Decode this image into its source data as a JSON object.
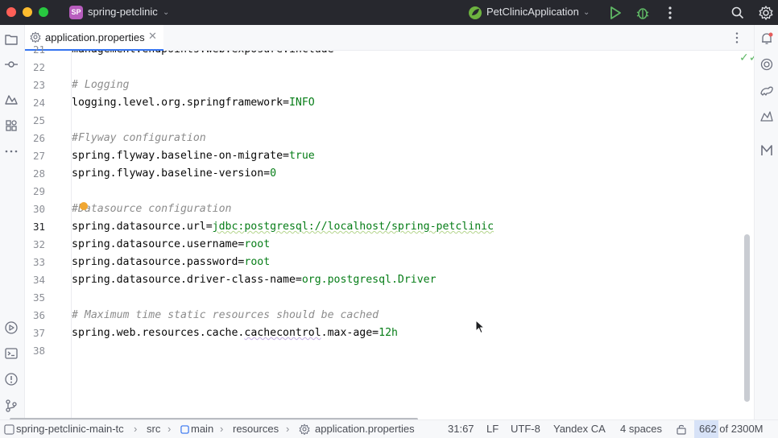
{
  "titlebar": {
    "project_badge": "SP",
    "project_name": "spring-petclinic",
    "run_config": "PetClinicApplication",
    "colors": {
      "close": "#ff5f57",
      "minimize": "#febc2e",
      "maximize": "#28c840",
      "run": "#5fb865",
      "badge": "#b85dbe"
    }
  },
  "tab": {
    "label": "application.properties",
    "close_icon": "close-icon"
  },
  "editor": {
    "partial_top_line": {
      "number": "21",
      "text": "management.endpoints.web.exposure.include=*"
    },
    "lines": [
      {
        "number": "22",
        "parts": []
      },
      {
        "number": "23",
        "parts": [
          {
            "t": "# Logging",
            "c": "comment"
          }
        ]
      },
      {
        "number": "24",
        "parts": [
          {
            "t": "logging.level.org.springframework=",
            "c": "key"
          },
          {
            "t": "INFO",
            "c": "val"
          }
        ]
      },
      {
        "number": "25",
        "parts": []
      },
      {
        "number": "26",
        "parts": [
          {
            "t": "#Flyway configuration",
            "c": "comment"
          }
        ]
      },
      {
        "number": "27",
        "parts": [
          {
            "t": "spring.flyway.baseline-on-migrate=",
            "c": "key"
          },
          {
            "t": "true",
            "c": "val"
          }
        ]
      },
      {
        "number": "28",
        "parts": [
          {
            "t": "spring.flyway.baseline-version=",
            "c": "key"
          },
          {
            "t": "0",
            "c": "val"
          }
        ]
      },
      {
        "number": "29",
        "parts": []
      },
      {
        "number": "30",
        "parts": [
          {
            "t": "#Datasource configuration",
            "c": "comment"
          }
        ]
      },
      {
        "number": "31",
        "parts": [
          {
            "t": "spring.datasource.url=",
            "c": "key"
          },
          {
            "t": "jdbc:postgresql://localhost/spring-petclinic",
            "c": "val"
          }
        ],
        "current": true
      },
      {
        "number": "32",
        "parts": [
          {
            "t": "spring.datasource.username=",
            "c": "key"
          },
          {
            "t": "root",
            "c": "val"
          }
        ]
      },
      {
        "number": "33",
        "parts": [
          {
            "t": "spring.datasource.password=",
            "c": "key"
          },
          {
            "t": "root",
            "c": "val"
          }
        ]
      },
      {
        "number": "34",
        "parts": [
          {
            "t": "spring.datasource.driver-class-name=",
            "c": "key"
          },
          {
            "t": "org.postgresql.Driver",
            "c": "val"
          }
        ]
      },
      {
        "number": "35",
        "parts": []
      },
      {
        "number": "36",
        "parts": [
          {
            "t": "# Maximum time static resources should be cached",
            "c": "comment"
          }
        ]
      },
      {
        "number": "37",
        "parts": [
          {
            "t": "spring.web.resources.cache.",
            "c": "key"
          },
          {
            "t": "cachecontrol",
            "c": "key-squig"
          },
          {
            "t": ".max-age=",
            "c": "key"
          },
          {
            "t": "12h",
            "c": "val"
          }
        ]
      },
      {
        "number": "38",
        "parts": []
      }
    ]
  },
  "breadcrumb": {
    "items": [
      "spring-petclinic-main-tc",
      "src",
      "main",
      "resources",
      "application.properties"
    ]
  },
  "status": {
    "position": "31:67",
    "line_separator": "LF",
    "encoding": "UTF-8",
    "certificate": "Yandex CA",
    "indent": "4 spaces",
    "memory": "662 of 2300M",
    "memory_fraction": 0.29
  },
  "icons": {
    "left_top": [
      "folder-icon",
      "commit-icon",
      "structure-icon",
      "plugins-icon",
      "more-icon"
    ],
    "left_bottom": [
      "run-icon",
      "terminal-icon",
      "problems-icon",
      "git-icon"
    ],
    "right": [
      "notifications-icon",
      "ai-assistant-icon",
      "gradle-icon",
      "database-icon",
      "maven-icon"
    ]
  }
}
